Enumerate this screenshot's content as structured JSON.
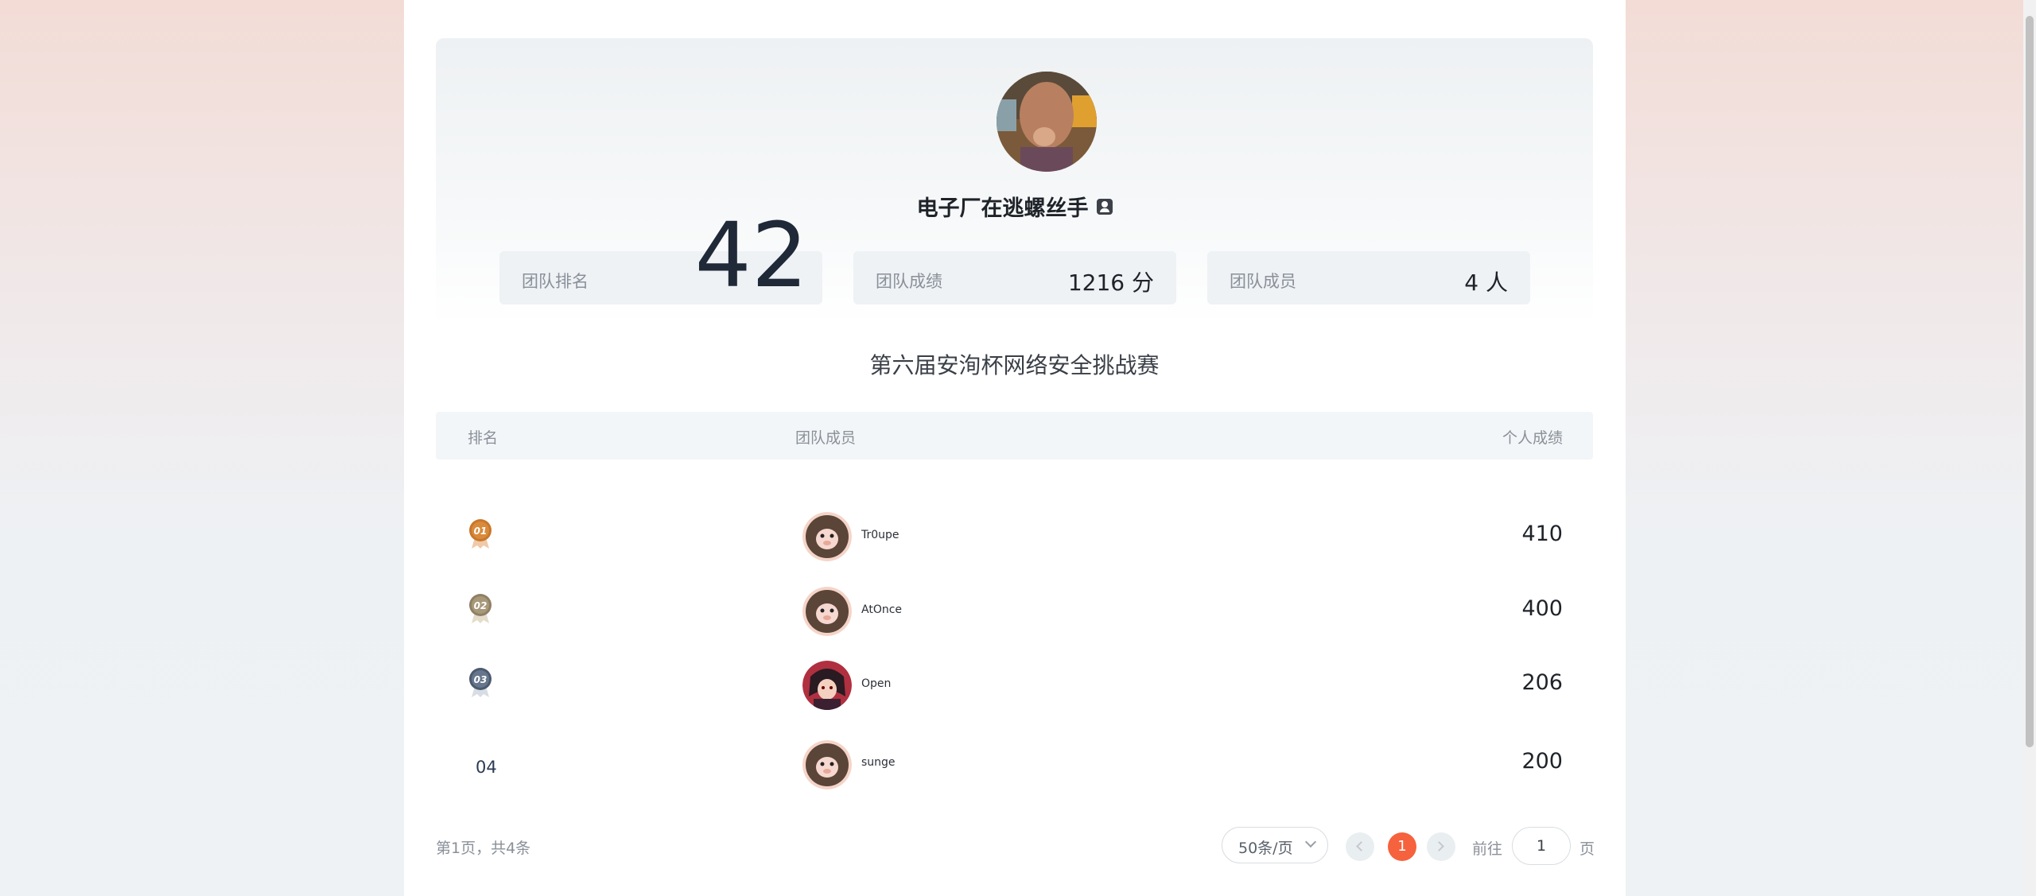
{
  "team": {
    "name": "电子厂在逃螺丝手",
    "stats": [
      {
        "label": "团队排名",
        "value": "42"
      },
      {
        "label": "团队成绩",
        "value": "1216 分"
      },
      {
        "label": "团队成员",
        "value": "4 人"
      }
    ]
  },
  "competition": {
    "title": "第六届安洵杯网络安全挑战赛"
  },
  "table": {
    "headers": [
      "排名",
      "团队成员",
      "个人成绩"
    ],
    "rows": [
      {
        "rank": "01",
        "name": "Tr0upe",
        "score": "410"
      },
      {
        "rank": "02",
        "name": "AtOnce",
        "score": "400"
      },
      {
        "rank": "03",
        "name": "Open",
        "score": "206"
      },
      {
        "rank": "04",
        "name": "sunge",
        "score": "200"
      }
    ]
  },
  "pagination": {
    "summary": "第1页，共4条",
    "page_size": "50条/页",
    "current_page": "1",
    "goto_label": "前往",
    "goto_value": "1",
    "goto_suffix": "页"
  },
  "colors": {
    "accent": "#f5623d",
    "gold": "#c8772b",
    "silver": "#9b8d72",
    "bronze": "#5c6b80"
  }
}
